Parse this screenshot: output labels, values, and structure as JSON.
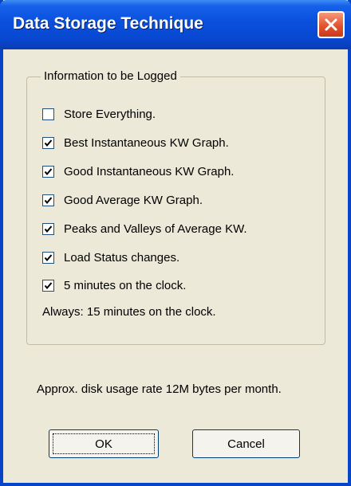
{
  "window": {
    "title": "Data Storage Technique"
  },
  "group": {
    "label": "Information to be Logged",
    "options": [
      {
        "label": "Store Everything.",
        "checked": false
      },
      {
        "label": "Best Instantaneous KW Graph.",
        "checked": true
      },
      {
        "label": "Good Instantaneous KW Graph.",
        "checked": true
      },
      {
        "label": "Good Average KW Graph.",
        "checked": true
      },
      {
        "label": "Peaks and Valleys of Average KW.",
        "checked": true
      },
      {
        "label": "Load Status changes.",
        "checked": true
      },
      {
        "label": "5 minutes on the clock.",
        "checked": true
      }
    ],
    "always_note": "Always: 15 minutes on the clock."
  },
  "usage_text": "Approx. disk usage rate 12M bytes per month.",
  "buttons": {
    "ok": "OK",
    "cancel": "Cancel"
  },
  "icons": {
    "close": "close-icon",
    "check": "checkmark-icon"
  },
  "colors": {
    "titlebar": "#0a4fdc",
    "close_button": "#e2532f",
    "dialog_bg": "#ece9d8"
  }
}
